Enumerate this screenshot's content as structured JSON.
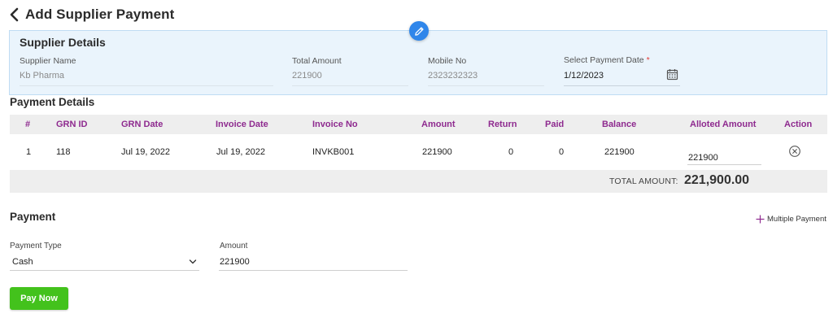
{
  "header": {
    "title": "Add Supplier Payment"
  },
  "supplier_details": {
    "title": "Supplier Details",
    "supplier_name": {
      "label": "Supplier Name",
      "value": "Kb Pharma"
    },
    "total_amount": {
      "label": "Total Amount",
      "value": "221900"
    },
    "mobile_no": {
      "label": "Mobile No",
      "value": "2323232323"
    },
    "payment_date": {
      "label": "Select Payment Date",
      "required": "*",
      "value": "1/12/2023"
    }
  },
  "payment_details": {
    "title": "Payment Details",
    "columns": [
      "#",
      "GRN ID",
      "GRN Date",
      "Invoice Date",
      "Invoice No",
      "Amount",
      "Return",
      "Paid",
      "Balance",
      "Alloted Amount",
      "Action"
    ],
    "rows": [
      {
        "index": "1",
        "grn_id": "118",
        "grn_date": "Jul 19, 2022",
        "invoice_date": "Jul 19, 2022",
        "invoice_no": "INVKB001",
        "amount": "221900",
        "return": "0",
        "paid": "0",
        "balance": "221900",
        "alloted_amount": "221900"
      }
    ],
    "total_label": "TOTAL AMOUNT:",
    "total_value": "221,900.00"
  },
  "payment": {
    "title": "Payment",
    "multiple_payment_label": "Multiple Payment",
    "payment_type": {
      "label": "Payment Type",
      "value": "Cash"
    },
    "amount": {
      "label": "Amount",
      "value": "221900"
    },
    "pay_now_label": "Pay Now"
  },
  "colors": {
    "accent": "#2f86ea",
    "header_text": "#8e2a8f",
    "pay_button": "#43c21c",
    "panel_bg": "#eaf4fc"
  }
}
